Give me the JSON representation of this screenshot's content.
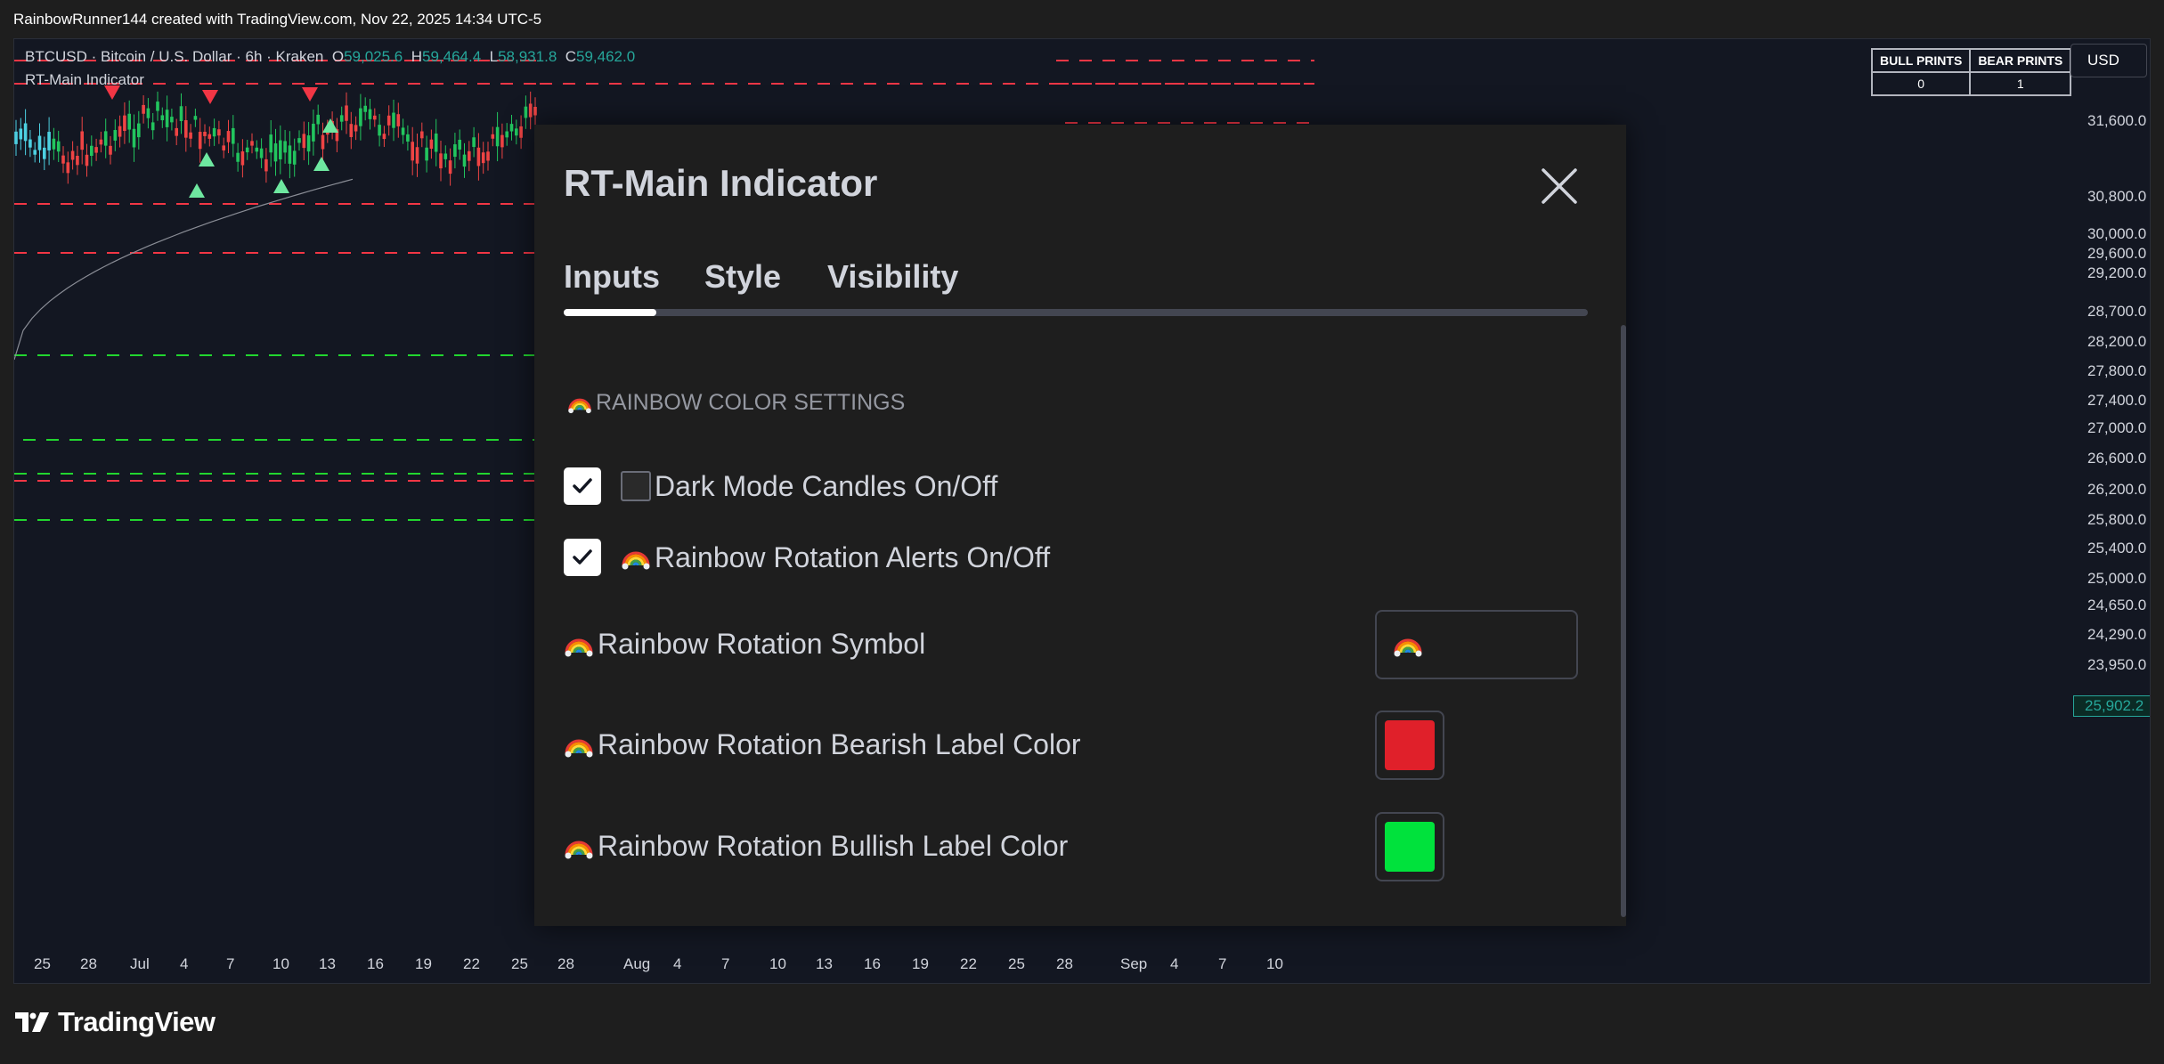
{
  "caption": "RainbowRunner144 created with TradingView.com, Nov 22, 2025 14:34 UTC-5",
  "symbol": {
    "name": "BTCUSD · Bitcoin / U.S. Dollar · 6h · Kraken",
    "o_label": "O",
    "o_value": "59,025.6",
    "h_label": "H",
    "h_value": "59,464.4",
    "l_label": "L",
    "l_value": "58,931.8",
    "c_label": "C",
    "c_value": "59,462.0"
  },
  "indicator_name": "RT-Main Indicator",
  "prints": {
    "bull_header": "BULL PRINTS",
    "bear_header": "BEAR PRINTS",
    "bull_value": "0",
    "bear_value": "1"
  },
  "currency": "USD",
  "price_axis": [
    "31,600.0",
    "30,800.0",
    "30,000.0",
    "29,600.0",
    "29,200.0",
    "28,700.0",
    "28,200.0",
    "27,800.0",
    "27,400.0",
    "27,000.0",
    "26,600.0",
    "26,200.0",
    "25,800.0",
    "25,400.0",
    "25,000.0",
    "24,650.0",
    "24,290.0",
    "23,950.0"
  ],
  "last_price": "25,902.2",
  "time_axis": [
    "25",
    "28",
    "Jul",
    "4",
    "7",
    "10",
    "13",
    "16",
    "19",
    "22",
    "25",
    "28",
    "Aug",
    "4",
    "7",
    "10",
    "13",
    "16",
    "19",
    "22",
    "25",
    "28",
    "Sep",
    "4",
    "7",
    "10"
  ],
  "brand": "TradingView",
  "dialog": {
    "title": "RT-Main Indicator",
    "tabs": [
      "Inputs",
      "Style",
      "Visibility"
    ],
    "active_tab": "Inputs",
    "section_title": "RAINBOW COLOR SETTINGS",
    "dark_mode_label": "Dark Mode Candles On/Off",
    "alerts_label": "Rainbow Rotation Alerts On/Off",
    "symbol_label": "Rainbow Rotation Symbol",
    "bearish_label": "Rainbow Rotation Bearish Label Color",
    "bullish_label": "Rainbow Rotation Bullish Label Color",
    "dark_mode_checked": true,
    "alerts_checked": true
  },
  "colors": {
    "bearish": "#e0202a",
    "bullish": "#00e23c",
    "up_candle": "#22c55e",
    "down_candle": "#ef4444",
    "bear_line": "#f23645",
    "bull_line": "#22d62f"
  },
  "icons": [
    "close-icon",
    "check-icon",
    "rainbow-icon",
    "tradingview-logo-icon"
  ]
}
